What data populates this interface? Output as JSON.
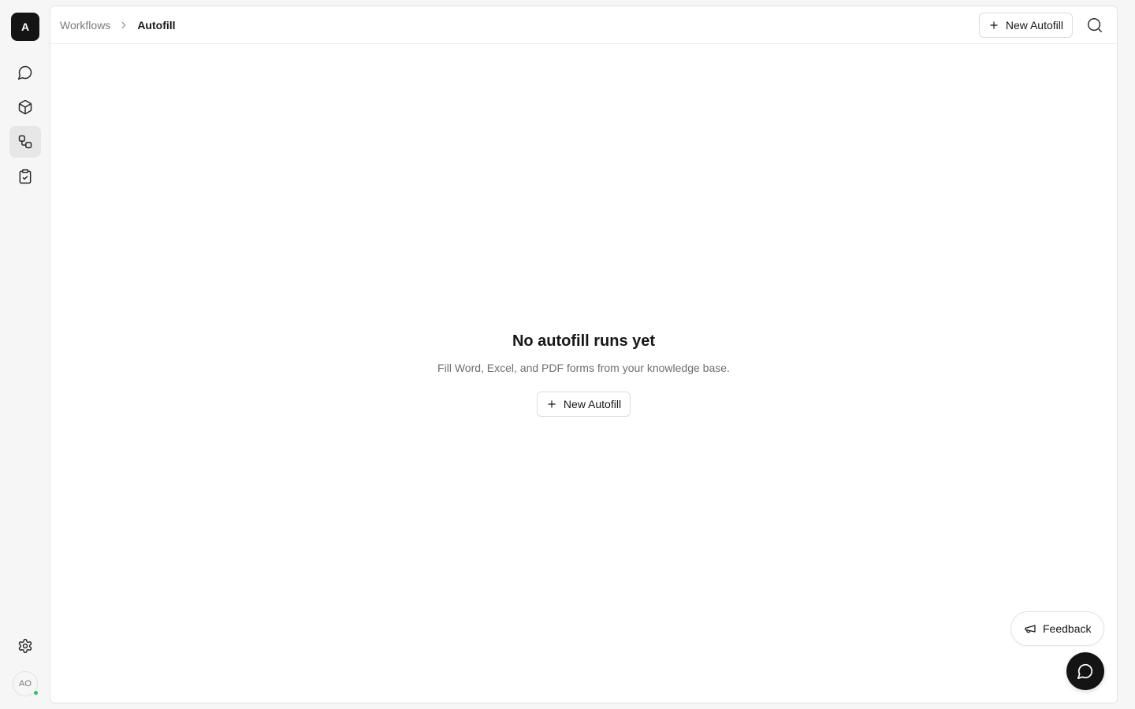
{
  "workspace": {
    "initial": "A"
  },
  "rail": {
    "items": [
      {
        "name": "chat",
        "icon": "message-circle-icon",
        "active": false
      },
      {
        "name": "knowledge",
        "icon": "cube-icon",
        "active": false
      },
      {
        "name": "workflows",
        "icon": "workflow-icon",
        "active": true
      },
      {
        "name": "tasks",
        "icon": "clipboard-check-icon",
        "active": false
      }
    ],
    "settings_icon": "gear-icon"
  },
  "user": {
    "initials": "AO",
    "status_color": "#22c55e"
  },
  "breadcrumb": {
    "parent": "Workflows",
    "current": "Autofill"
  },
  "header": {
    "new_button_label": "New Autofill",
    "search_icon": "search-icon"
  },
  "empty_state": {
    "title": "No autofill runs yet",
    "subtitle": "Fill Word, Excel, and PDF forms from your knowledge base.",
    "button_label": "New Autofill"
  },
  "feedback": {
    "label": "Feedback"
  },
  "colors": {
    "accent_dark": "#141414",
    "active_nav_bg": "#e7e7e7",
    "muted_text": "#6e6e6e"
  }
}
